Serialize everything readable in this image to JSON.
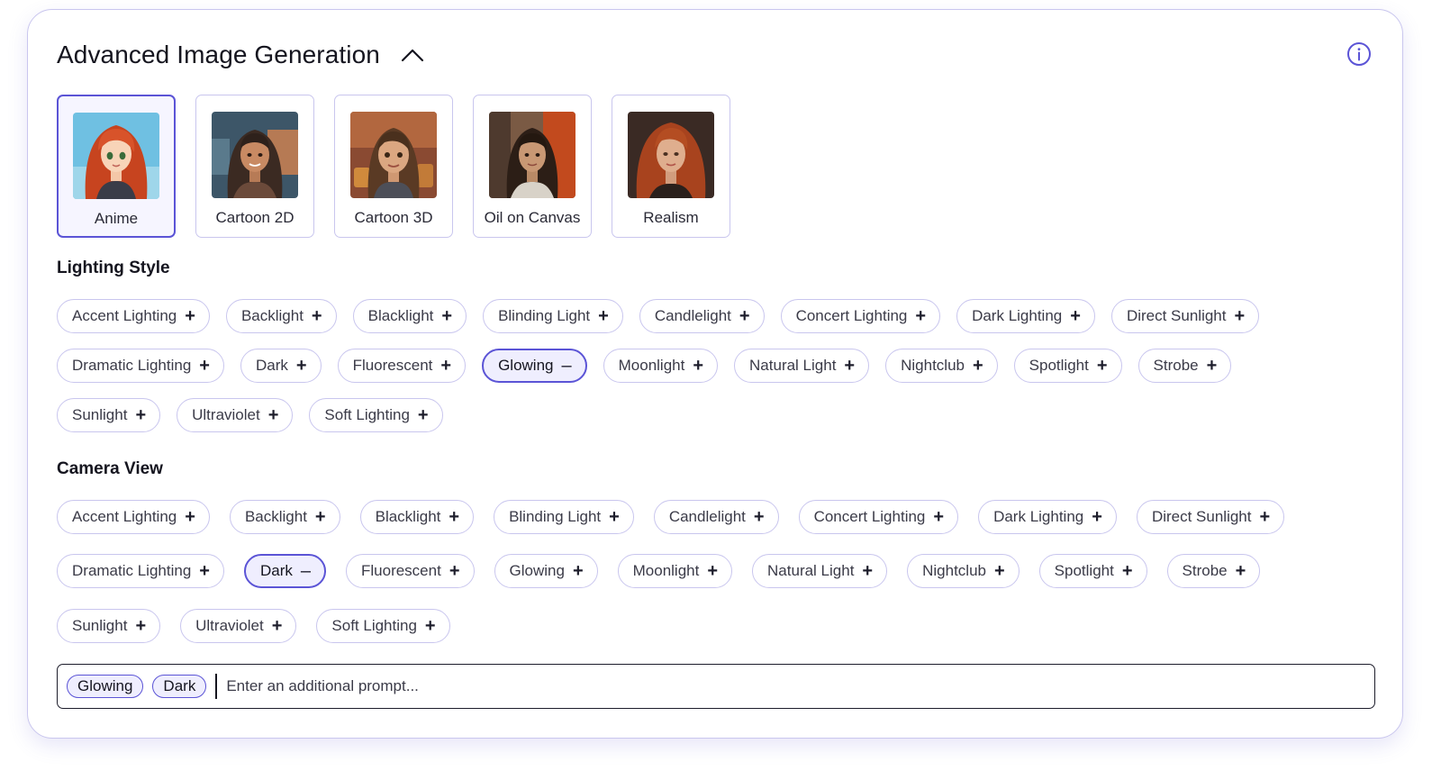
{
  "header": {
    "title": "Advanced Image Generation"
  },
  "styles": [
    {
      "label": "Anime",
      "selected": true
    },
    {
      "label": "Cartoon 2D",
      "selected": false
    },
    {
      "label": "Cartoon 3D",
      "selected": false
    },
    {
      "label": "Oil on Canvas",
      "selected": false
    },
    {
      "label": "Realism",
      "selected": false
    }
  ],
  "lighting": {
    "title": "Lighting Style",
    "rows": [
      [
        {
          "label": "Accent Lighting"
        },
        {
          "label": "Backlight"
        },
        {
          "label": "Blacklight"
        },
        {
          "label": "Blinding Light"
        },
        {
          "label": "Candlelight"
        },
        {
          "label": "Concert Lighting"
        },
        {
          "label": "Dark Lighting"
        },
        {
          "label": "Direct Sunlight"
        }
      ],
      [
        {
          "label": "Dramatic Lighting"
        },
        {
          "label": "Dark"
        },
        {
          "label": "Fluorescent"
        },
        {
          "label": "Glowing",
          "active": true
        },
        {
          "label": "Moonlight"
        },
        {
          "label": "Natural Light"
        },
        {
          "label": "Nightclub"
        },
        {
          "label": "Spotlight"
        },
        {
          "label": "Strobe"
        }
      ],
      [
        {
          "label": "Sunlight"
        },
        {
          "label": "Ultraviolet"
        },
        {
          "label": "Soft Lighting"
        }
      ]
    ]
  },
  "camera": {
    "title": "Camera View",
    "rows": [
      [
        {
          "label": "Accent Lighting"
        },
        {
          "label": "Backlight"
        },
        {
          "label": "Blacklight"
        },
        {
          "label": "Blinding Light"
        },
        {
          "label": "Candlelight"
        },
        {
          "label": "Concert Lighting"
        },
        {
          "label": "Dark Lighting"
        },
        {
          "label": "Direct Sunlight"
        }
      ],
      [
        {
          "label": "Dramatic Lighting"
        },
        {
          "label": "Dark",
          "active": true
        },
        {
          "label": "Fluorescent"
        },
        {
          "label": "Glowing"
        },
        {
          "label": "Moonlight"
        },
        {
          "label": "Natural Light"
        },
        {
          "label": "Nightclub"
        },
        {
          "label": "Spotlight"
        },
        {
          "label": "Strobe"
        }
      ],
      [
        {
          "label": "Sunlight"
        },
        {
          "label": "Ultraviolet"
        },
        {
          "label": "Soft Lighting"
        }
      ]
    ]
  },
  "prompt": {
    "tags": [
      "Glowing",
      "Dark"
    ],
    "placeholder": "Enter an additional prompt...",
    "value": ""
  },
  "icons": {
    "collapse": "chevron-up-icon",
    "info": "info-icon",
    "add": "plus-icon",
    "remove": "minus-icon"
  },
  "colors": {
    "accent": "#5b54d6",
    "border": "#c9c6ee",
    "active_bg": "#efeefe"
  }
}
